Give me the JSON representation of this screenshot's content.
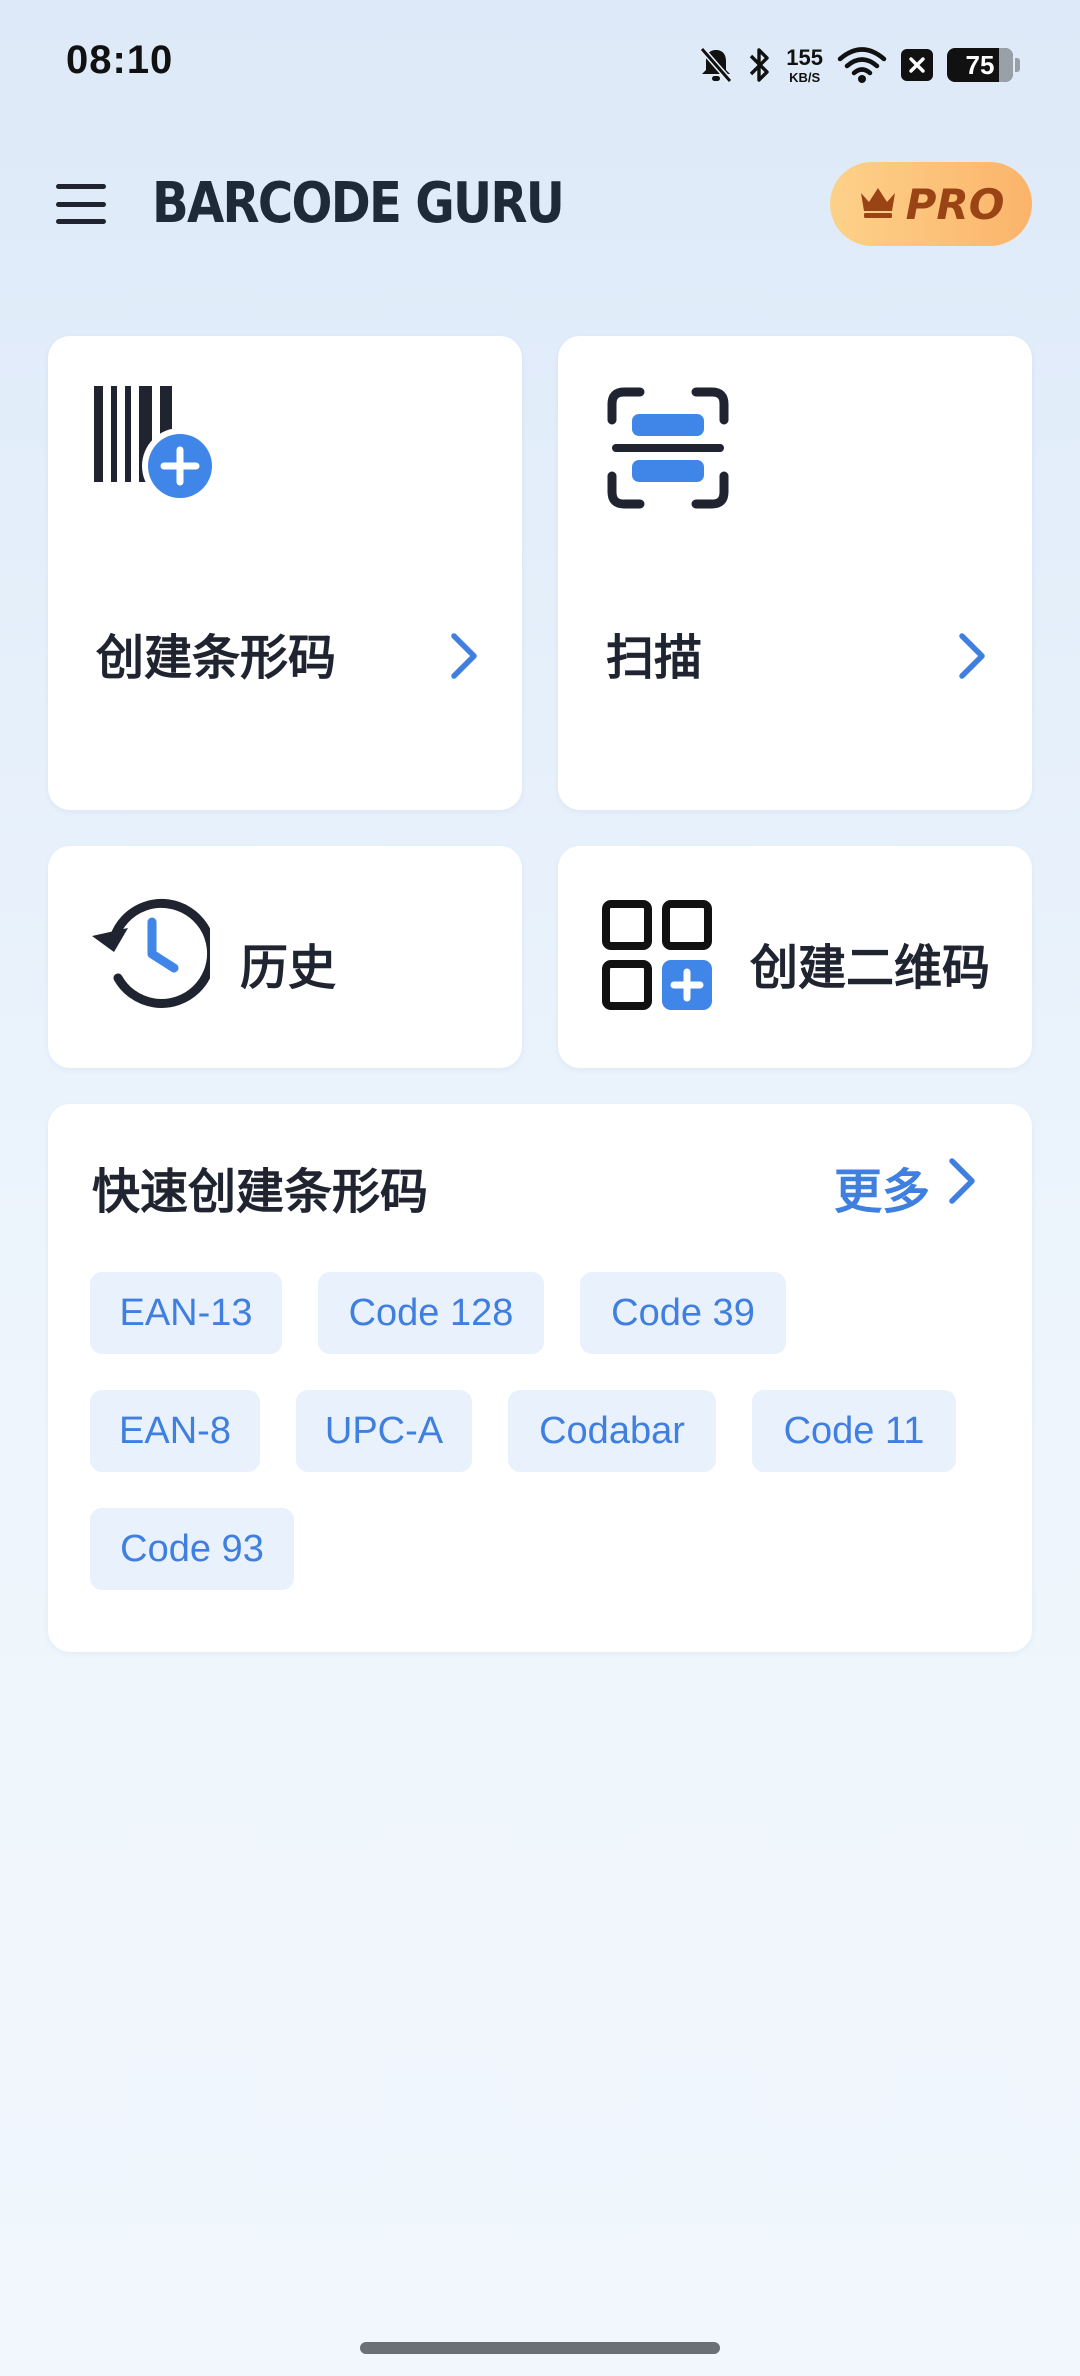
{
  "status_bar": {
    "time": "08:10",
    "net_speed_value": "155",
    "net_speed_unit": "KB/S",
    "battery_level": "75",
    "icons": [
      "bell-off-icon",
      "bluetooth-icon",
      "wifi-icon",
      "close-box-icon",
      "battery-icon"
    ]
  },
  "app_bar": {
    "menu_icon": "hamburger-menu-icon",
    "title": "BARCODE GURU",
    "pro_label": "PRO",
    "pro_icon": "crown-icon"
  },
  "cards": {
    "create_barcode": {
      "label": "创建条形码",
      "icon": "barcode-add-icon"
    },
    "scan": {
      "label": "扫描",
      "icon": "scan-frame-icon"
    },
    "history": {
      "label": "历史",
      "icon": "history-clock-icon"
    },
    "create_qr": {
      "label": "创建二维码",
      "icon": "qr-add-icon"
    }
  },
  "quick_create": {
    "title": "快速创建条形码",
    "more_label": "更多",
    "chips": [
      "EAN-13",
      "Code 128",
      "Code 39",
      "EAN-8",
      "UPC-A",
      "Codabar",
      "Code 11",
      "Code 93"
    ]
  },
  "colors": {
    "accent": "#3f7fe0",
    "chip_bg": "#e9f1fc",
    "pro_gradient_start": "#fdd18a",
    "pro_gradient_end": "#fbb46a",
    "pro_text": "#9a4416"
  }
}
